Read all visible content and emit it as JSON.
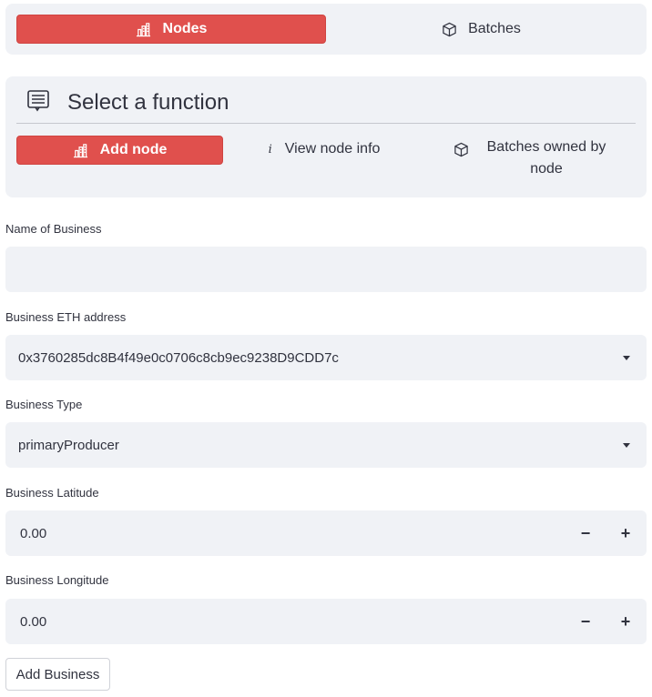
{
  "top_nav": {
    "items": [
      {
        "label": "Nodes",
        "icon": "building-chart-icon",
        "active": true
      },
      {
        "label": "Batches",
        "icon": "box-icon",
        "active": false
      }
    ]
  },
  "function_panel": {
    "title": "Select a function",
    "icon": "list-window-icon",
    "options": [
      {
        "label": "Add node",
        "icon": "building-chart-icon",
        "active": true
      },
      {
        "label": "View node info",
        "icon": "info-icon",
        "active": false
      },
      {
        "label": "Batches owned by node",
        "icon": "box-icon",
        "active": false
      }
    ]
  },
  "form": {
    "business_name": {
      "label": "Name of Business",
      "value": ""
    },
    "eth_address": {
      "label": "Business ETH address",
      "value": "0x3760285dc8B4f49e0c0706c8cb9ec9238D9CDD7c"
    },
    "business_type": {
      "label": "Business Type",
      "value": "primaryProducer"
    },
    "latitude": {
      "label": "Business Latitude",
      "value": "0.00",
      "minus": "−",
      "plus": "+"
    },
    "longitude": {
      "label": "Business Longitude",
      "value": "0.00",
      "minus": "−",
      "plus": "+"
    },
    "submit_label": "Add Business"
  },
  "colors": {
    "accent": "#e0504d",
    "panel_bg": "#f0f2f6",
    "text": "#31333f"
  }
}
